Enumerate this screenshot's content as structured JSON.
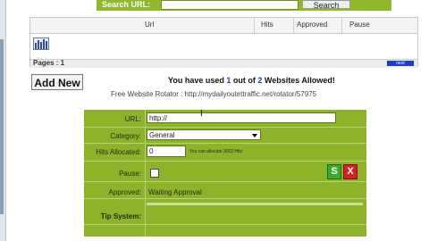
{
  "search": {
    "label": "Search URL:",
    "value": "",
    "button": "Search"
  },
  "table": {
    "headers": [
      "Url",
      "Hits",
      "Approved",
      "Pause"
    ],
    "pages_label": "Pages : 1",
    "next_label": "next"
  },
  "toolbar": {
    "add_new": "Add New"
  },
  "usage": {
    "prefix": "You have used ",
    "used": "1",
    "middle": " out of ",
    "total": "2",
    "suffix": " Websites Allowed!"
  },
  "rotator": {
    "text": "Free Website Rotator : http://mydailyoutettraffic.net/rotator/57975"
  },
  "form": {
    "url_label": "URL:",
    "url_value": "http://",
    "category_label": "Category:",
    "category_value": "General",
    "hits_label": "Hits Allocated:",
    "hits_value": "0",
    "hits_note": "You can allocate 3002 Hits",
    "pause_label": "Pause:",
    "approved_label": "Approved:",
    "approved_value": "Waiting Approval",
    "tip_label": "Tip System:",
    "save_label": "S",
    "cancel_label": "X"
  },
  "colors": {
    "panel": "#8db32a",
    "accent_blue": "#1b3bd1",
    "save": "#3daa2c",
    "cancel": "#d42222"
  },
  "icons": [
    "bar-chart-icon",
    "save-icon",
    "cancel-icon",
    "mouse-cursor-icon"
  ]
}
